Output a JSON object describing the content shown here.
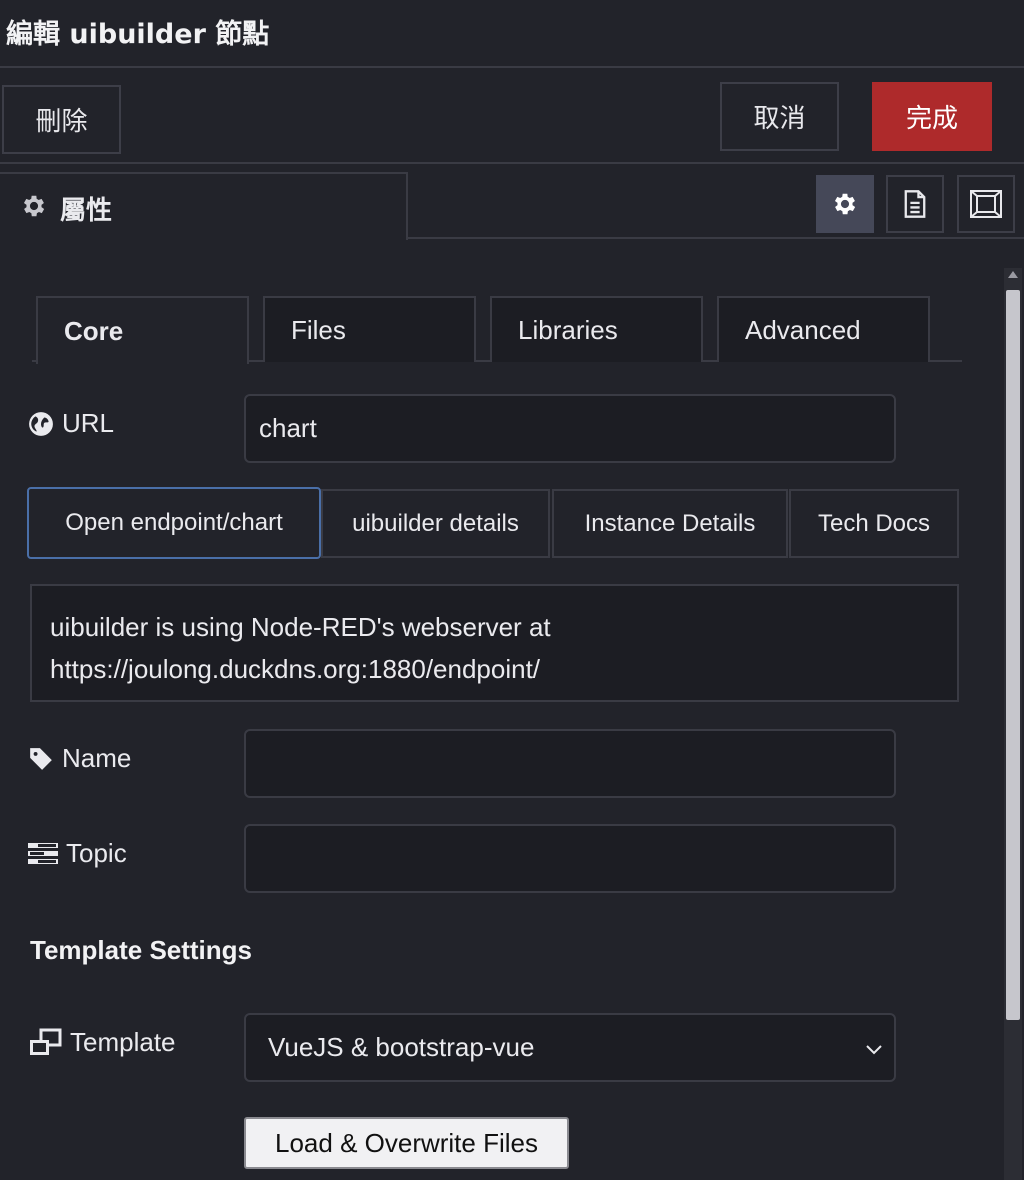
{
  "dialog": {
    "title": "編輯 uibuilder 節點"
  },
  "toolbar": {
    "delete_label": "刪除",
    "cancel_label": "取消",
    "done_label": "完成",
    "done_color": "#ae2a2b"
  },
  "panel_tabs": {
    "properties_label": "屬性",
    "icons": [
      "gear-icon",
      "description-icon",
      "appearance-icon"
    ]
  },
  "subtabs": [
    {
      "label": "Core",
      "active": true
    },
    {
      "label": "Files",
      "active": false
    },
    {
      "label": "Libraries",
      "active": false
    },
    {
      "label": "Advanced",
      "active": false
    }
  ],
  "url": {
    "label": "URL",
    "value": "chart"
  },
  "link_buttons": [
    "Open endpoint/chart",
    "uibuilder details",
    "Instance Details",
    "Tech Docs"
  ],
  "info": {
    "line1": "uibuilder is using Node-RED's webserver at",
    "line2": "https://joulong.duckdns.org:1880/endpoint/"
  },
  "name": {
    "label": "Name",
    "value": ""
  },
  "topic": {
    "label": "Topic",
    "value": ""
  },
  "template_settings": {
    "title": "Template Settings",
    "template_label": "Template",
    "template_value": "VueJS & bootstrap-vue",
    "load_button": "Load & Overwrite Files"
  }
}
